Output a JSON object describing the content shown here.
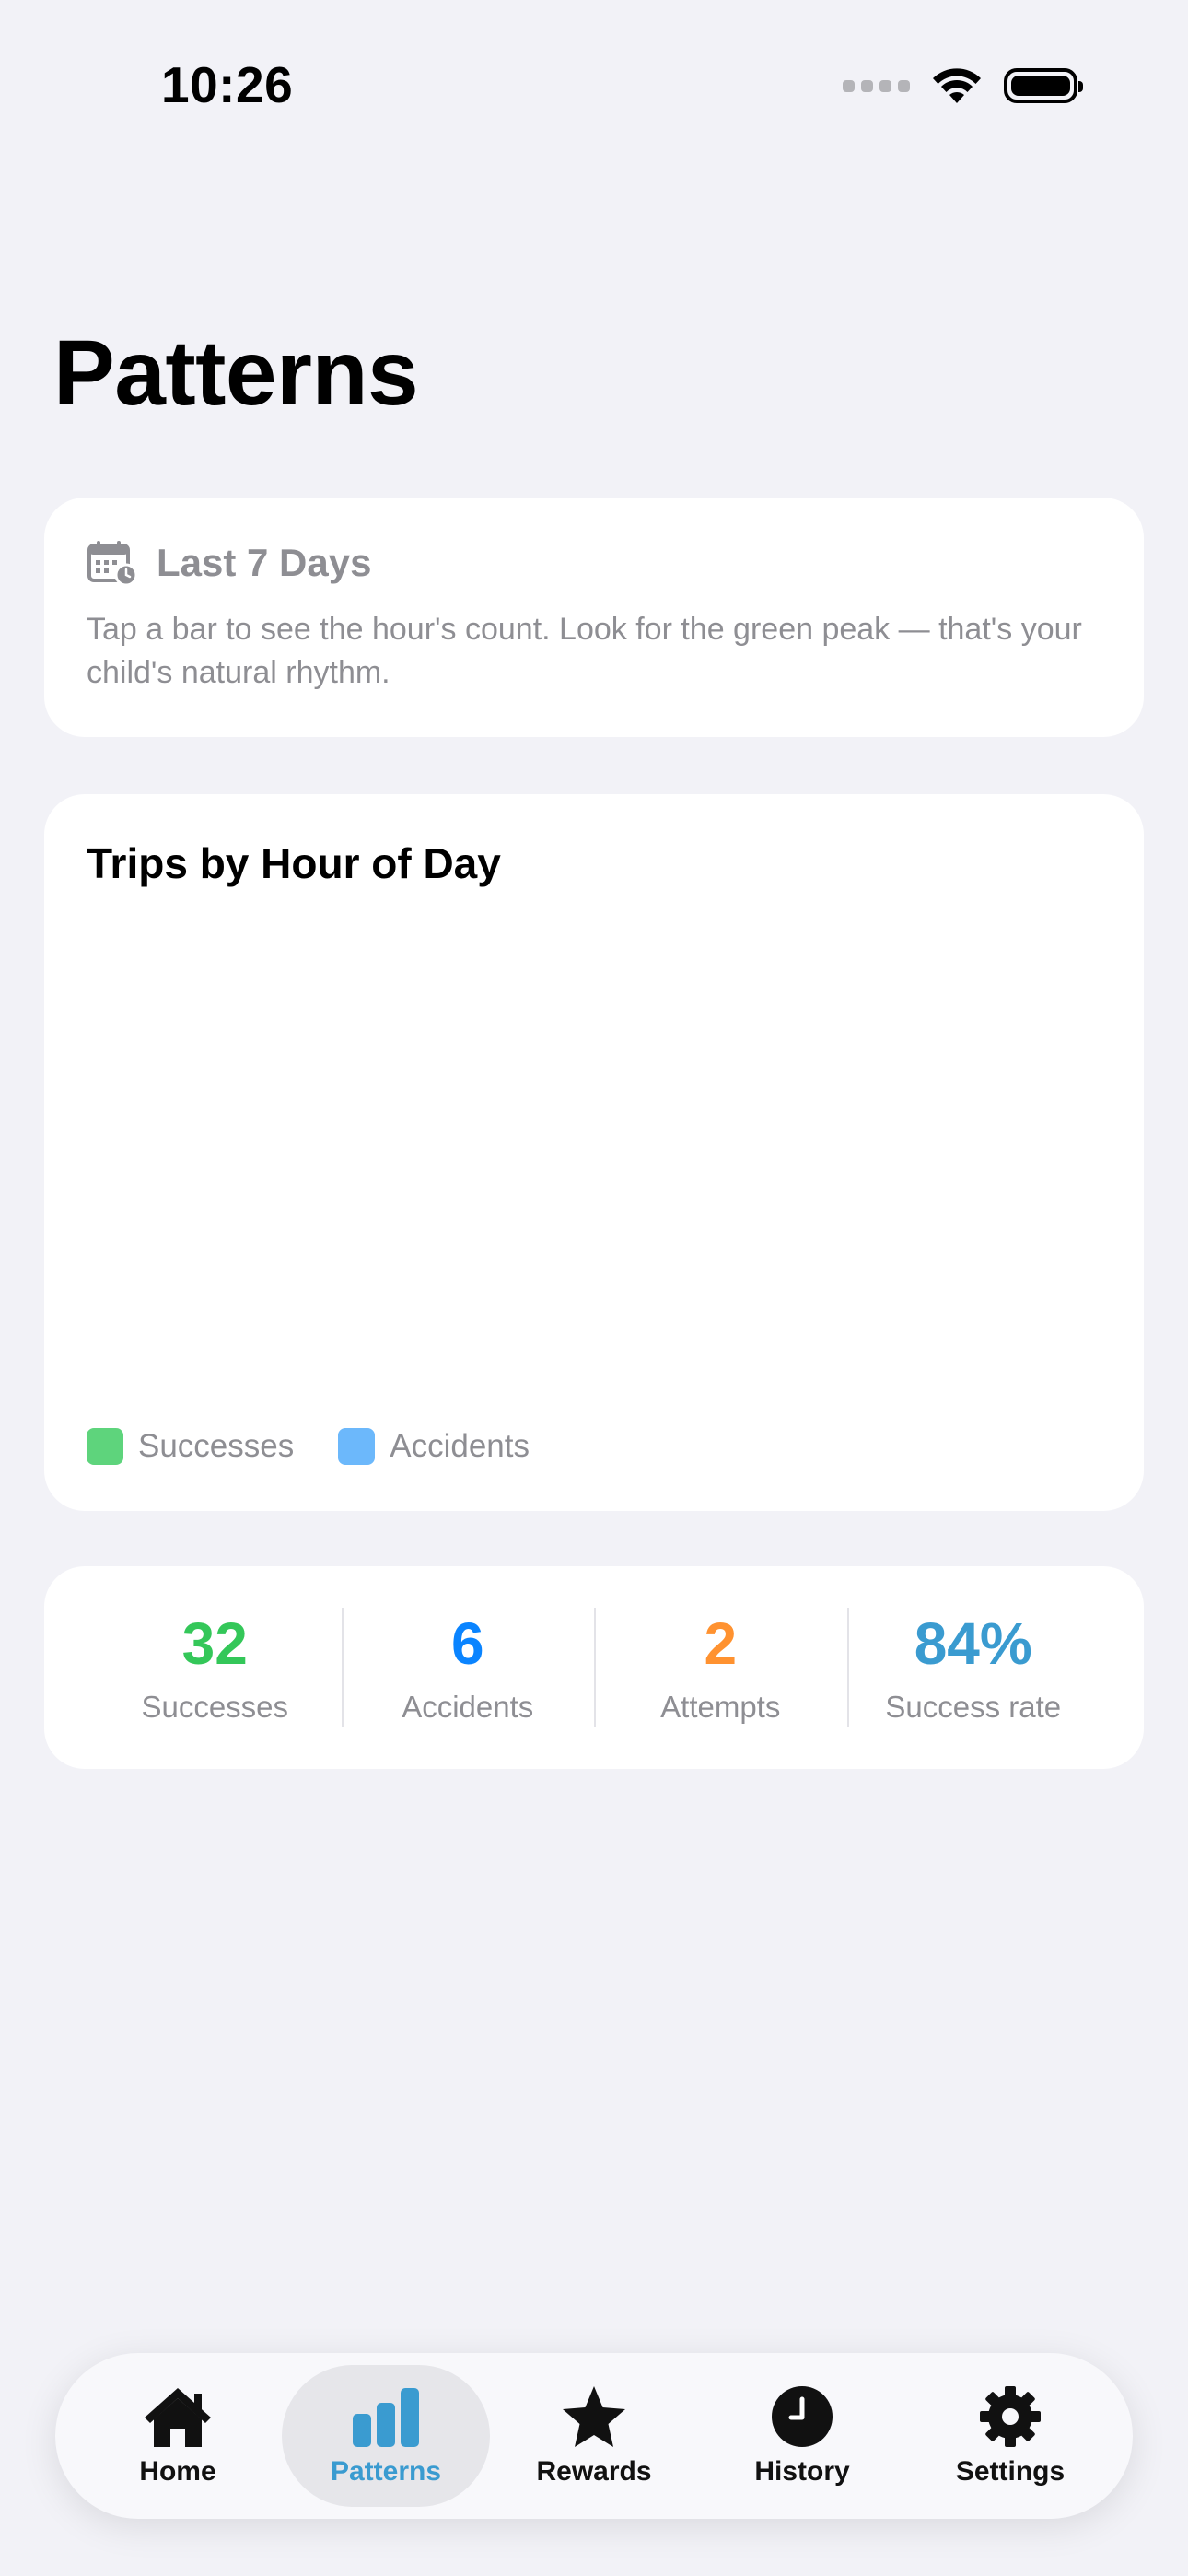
{
  "status_bar": {
    "time": "10:26"
  },
  "page": {
    "title": "Patterns"
  },
  "info_card": {
    "icon": "calendar-clock-icon",
    "title": "Last 7 Days",
    "description": "Tap a bar to see the hour's count. Look for the green peak — that's your child's natural rhythm."
  },
  "chart_card": {
    "title": "Trips by Hour of Day",
    "legend": [
      {
        "label": "Successes",
        "color": "#5ed47c"
      },
      {
        "label": "Accidents",
        "color": "#6cb8fb"
      }
    ]
  },
  "chart_data": {
    "type": "bar",
    "title": "Trips by Hour of Day",
    "categories": [],
    "series": [
      {
        "name": "Successes",
        "values": []
      },
      {
        "name": "Accidents",
        "values": []
      }
    ]
  },
  "stats": [
    {
      "value": "32",
      "label": "Successes",
      "color": "#34c759"
    },
    {
      "value": "6",
      "label": "Accidents",
      "color": "#0a84ff"
    },
    {
      "value": "2",
      "label": "Attempts",
      "color": "#ff9230"
    },
    {
      "value": "84%",
      "label": "Success rate",
      "color": "#3a9bd0"
    }
  ],
  "tab_bar": {
    "accent": "#3a9bd0",
    "tabs": [
      {
        "label": "Home",
        "icon": "house-icon",
        "active": false
      },
      {
        "label": "Patterns",
        "icon": "bar-chart-icon",
        "active": true
      },
      {
        "label": "Rewards",
        "icon": "star-icon",
        "active": false
      },
      {
        "label": "History",
        "icon": "clock-icon",
        "active": false
      },
      {
        "label": "Settings",
        "icon": "gear-icon",
        "active": false
      }
    ]
  }
}
